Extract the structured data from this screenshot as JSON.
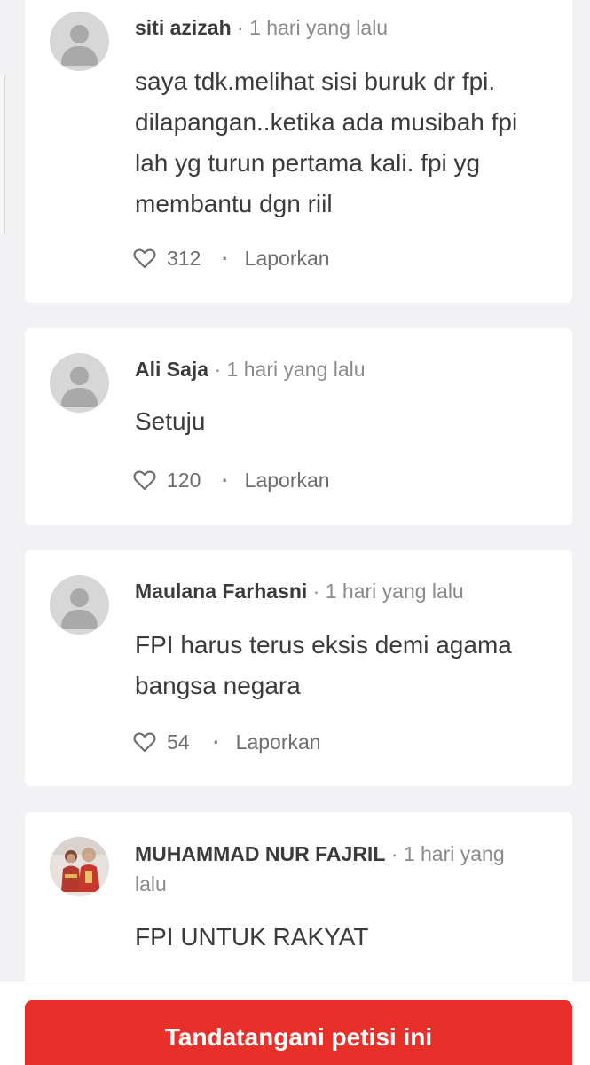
{
  "comments": [
    {
      "author": "siti azizah",
      "time": "1 hari yang lalu",
      "text": "saya tdk.melihat sisi buruk dr fpi. dilapangan..ketika ada musibah fpi lah yg turun pertama kali. fpi yg membantu dgn riil",
      "likes": "312",
      "report_label": "Laporkan",
      "avatar": "default-user-avatar"
    },
    {
      "author": "Ali Saja",
      "time": "1 hari yang lalu",
      "text": "Setuju",
      "likes": "120",
      "report_label": "Laporkan",
      "avatar": "default-user-avatar"
    },
    {
      "author": "Maulana Farhasni",
      "time": "1 hari yang lalu",
      "text": "FPI harus terus eksis demi agama bangsa negara",
      "likes": "54",
      "report_label": "Laporkan",
      "avatar": "default-user-avatar"
    },
    {
      "author": "MUHAMMAD NUR FAJRIL",
      "time": "1 hari yang lalu",
      "text": "FPI UNTUK RAKYAT",
      "avatar": "user-photo"
    }
  ],
  "separator": "·",
  "footer": {
    "sign_button_label": "Tandatangani petisi ini"
  },
  "colors": {
    "background": "#f2f1f3",
    "card": "#ffffff",
    "accent": "#e8302b",
    "text": "#3c3a3b",
    "muted": "#8b8a8b"
  },
  "icons": {
    "like": "heart-icon",
    "separator": "dot"
  }
}
